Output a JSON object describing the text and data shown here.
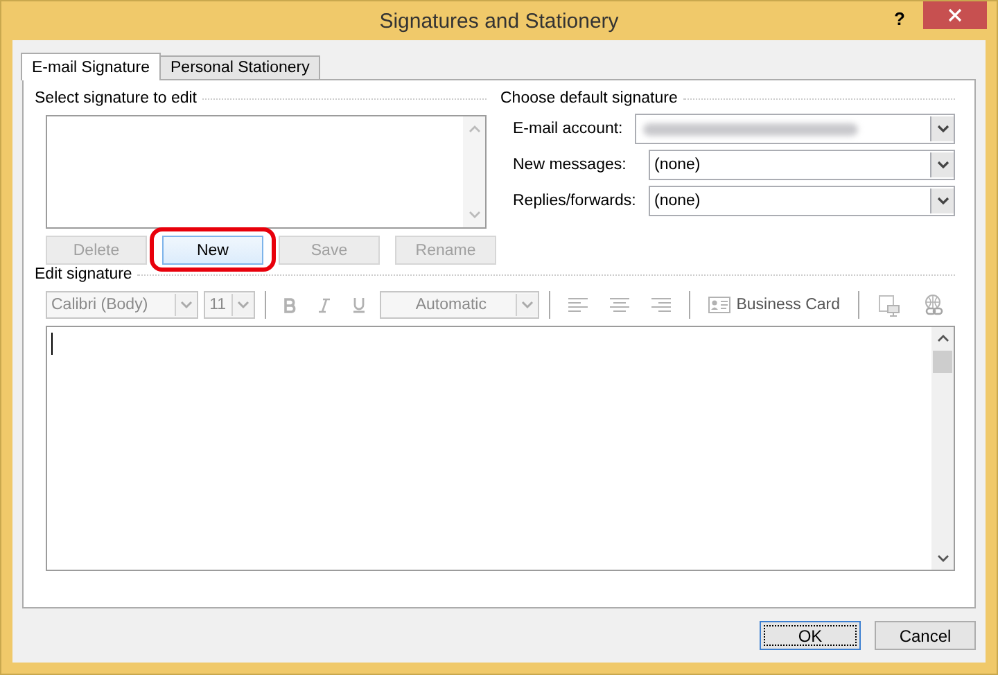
{
  "window": {
    "title": "Signatures and Stationery",
    "help": "?"
  },
  "tabs": [
    {
      "label": "E-mail Signature",
      "selected": true
    },
    {
      "label": "Personal Stationery",
      "selected": false
    }
  ],
  "select_signature": {
    "label": "Select signature to edit",
    "buttons": [
      {
        "label": "Delete",
        "disabled": true,
        "highlighted": false
      },
      {
        "label": "New",
        "disabled": false,
        "highlighted": true
      },
      {
        "label": "Save",
        "disabled": true,
        "highlighted": false
      },
      {
        "label": "Rename",
        "disabled": true,
        "highlighted": false
      }
    ]
  },
  "default_signature": {
    "label": "Choose default signature",
    "fields": [
      {
        "label": "E-mail account:",
        "value_blurred": true
      },
      {
        "label": "New messages:",
        "value": "(none)"
      },
      {
        "label": "Replies/forwards:",
        "value": "(none)"
      }
    ]
  },
  "edit_signature": {
    "label": "Edit signature",
    "toolbar": [
      {
        "kind": "combo",
        "value": "Calibri (Body)",
        "disabled": true
      },
      {
        "kind": "combo",
        "value": "11",
        "disabled": true
      },
      {
        "kind": "bold",
        "disabled": true
      },
      {
        "kind": "italic",
        "disabled": true
      },
      {
        "kind": "underline",
        "disabled": true
      },
      {
        "kind": "combo",
        "value": "Automatic",
        "disabled": true
      },
      {
        "kind": "align-left",
        "disabled": true
      },
      {
        "kind": "align-center",
        "disabled": true
      },
      {
        "kind": "align-right",
        "disabled": true
      },
      {
        "kind": "card",
        "label": "Business Card",
        "disabled": true
      },
      {
        "kind": "picture",
        "disabled": true
      },
      {
        "kind": "link",
        "disabled": true
      }
    ]
  },
  "footer_buttons": [
    {
      "label": "OK",
      "default": true
    },
    {
      "label": "Cancel",
      "default": false
    }
  ]
}
